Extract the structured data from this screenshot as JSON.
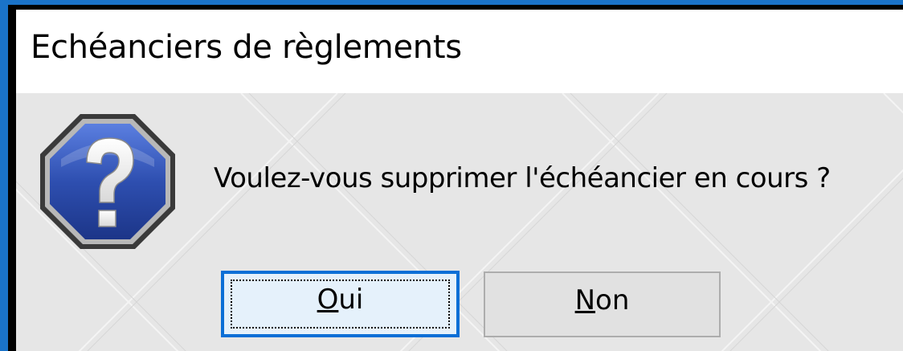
{
  "window": {
    "title": "Echéanciers de règlements"
  },
  "dialog": {
    "icon": "question-icon",
    "message": "Voulez-vous supprimer l'échéancier en cours ?"
  },
  "buttons": {
    "yes": {
      "accel": "O",
      "rest": "ui"
    },
    "no": {
      "accel": "N",
      "rest": "on"
    }
  },
  "colors": {
    "accent_border": "#1a73c9",
    "focused_button_border": "#0b6fd6",
    "icon_fill": "#2e4fb0",
    "content_background": "#e6e6e6"
  }
}
